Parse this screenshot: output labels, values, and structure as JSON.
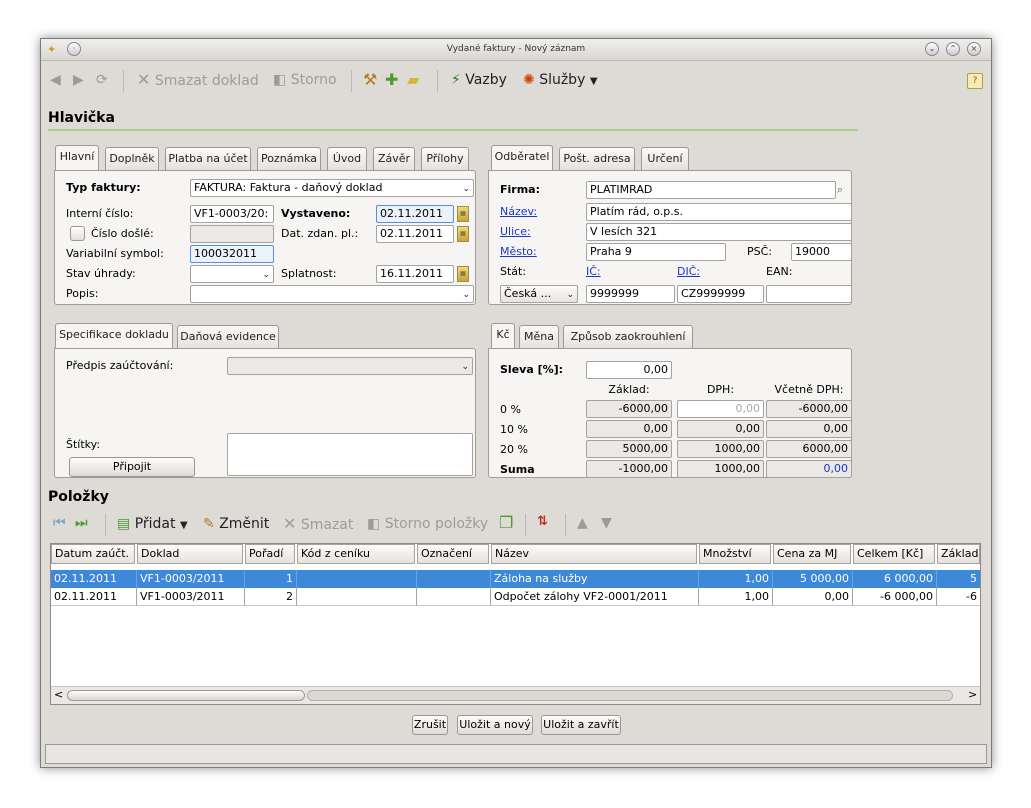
{
  "window": {
    "title": "Vydané faktury - Nový záznam"
  },
  "toolbar": {
    "delete": "Smazat doklad",
    "storno": "Storno",
    "links": "Vazby",
    "services": "Služby"
  },
  "header_section": {
    "title": "Hlavička"
  },
  "left_tabs": [
    "Hlavní",
    "Doplněk",
    "Platba na účet",
    "Poznámka",
    "Úvod",
    "Závěr",
    "Přílohy"
  ],
  "main": {
    "invoice_type_label": "Typ faktury:",
    "invoice_type_value": "FAKTURA: Faktura - daňový doklad",
    "internal_no_label": "Interní číslo:",
    "internal_no_value": "VF1-0003/20:",
    "issued_label": "Vystaveno:",
    "issued_value": "02.11.2011",
    "received_no_label": "Číslo došlé:",
    "received_no_value": "",
    "tax_date_label": "Dat. zdan. pl.:",
    "tax_date_value": "02.11.2011",
    "var_symbol_label": "Variabilní symbol:",
    "var_symbol_value": "100032011",
    "pay_status_label": "Stav úhrady:",
    "pay_status_value": "",
    "due_label": "Splatnost:",
    "due_value": "16.11.2011",
    "desc_label": "Popis:",
    "desc_value": ""
  },
  "right_tabs": [
    "Odběratel",
    "Pošt. adresa",
    "Určení"
  ],
  "customer": {
    "firm_label": "Firma:",
    "firm_value": "PLATIMRAD",
    "name_label": "Název:",
    "name_value": "Platím rád, o.p.s.",
    "street_label": "Ulice:",
    "street_value": "V lesích 321",
    "city_label": "Město:",
    "city_value": "Praha 9",
    "zip_label": "PSČ:",
    "zip_value": "19000",
    "country_label": "Stát:",
    "country_value": "Česká ...",
    "ic_label": "IČ:",
    "ic_value": "9999999",
    "dic_label": "DIČ:",
    "dic_value": "CZ9999999",
    "ean_label": "EAN:",
    "ean_value": ""
  },
  "spec_tabs": [
    "Specifikace dokladu",
    "Daňová evidence"
  ],
  "spec": {
    "posting_label": "Předpis zaúčtování:",
    "posting_value": "",
    "tags_label": "Štítky:",
    "attach_button": "Připojit",
    "tags_value": ""
  },
  "currency_tabs": [
    "Kč",
    "Měna",
    "Způsob zaokrouhlení"
  ],
  "totals": {
    "discount_label": "Sleva [%]:",
    "discount_value": "0,00",
    "col_base": "Základ:",
    "col_vat": "DPH:",
    "col_total": "Včetně DPH:",
    "rows": [
      {
        "rate": "0 %",
        "base": "-6000,00",
        "vat": "0,00",
        "total": "-6000,00"
      },
      {
        "rate": "10 %",
        "base": "0,00",
        "vat": "0,00",
        "total": "0,00"
      },
      {
        "rate": "20 %",
        "base": "5000,00",
        "vat": "1000,00",
        "total": "6000,00"
      }
    ],
    "sum_label": "Suma",
    "sum_base": "-1000,00",
    "sum_vat": "1000,00",
    "sum_total": "0,00"
  },
  "items_section": {
    "title": "Položky",
    "add": "Přidat",
    "edit": "Změnit",
    "delete": "Smazat",
    "storno": "Storno položky"
  },
  "grid": {
    "columns": [
      "Datum zaúčt.",
      "Doklad",
      "Pořadí",
      "Kód z ceníku",
      "Označení",
      "Název",
      "Množství",
      "Cena za MJ",
      "Celkem [Kč]",
      "Základ ["
    ],
    "rows": [
      [
        "02.11.2011",
        "VF1-0003/2011",
        "1",
        "",
        "",
        "Záloha na služby",
        "1,00",
        "5 000,00",
        "6 000,00",
        "5"
      ],
      [
        "02.11.2011",
        "VF1-0003/2011",
        "2",
        "",
        "",
        "Odpočet zálohy VF2-0001/2011",
        "1,00",
        "0,00",
        "-6 000,00",
        "-6"
      ]
    ]
  },
  "buttons": {
    "cancel": "Zrušit",
    "save_new": "Uložit a nový",
    "save_close": "Uložit a zavřít"
  }
}
